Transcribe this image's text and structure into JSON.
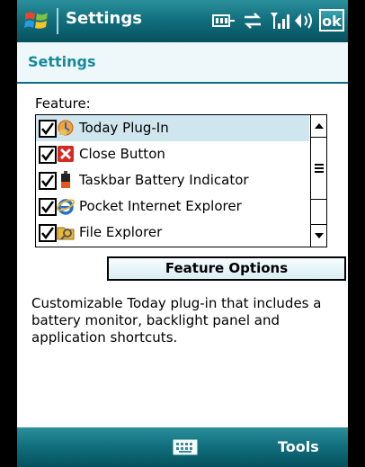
{
  "titlebar": {
    "title": "Settings",
    "start_icon": "windows-flag-icon",
    "status_icons": [
      "connectivity-icon",
      "sync-icon",
      "signal-icon",
      "volume-icon"
    ],
    "ok_label": "ok"
  },
  "header": {
    "title": "Settings"
  },
  "feature_list": {
    "label": "Feature:",
    "items": [
      {
        "label": "Today Plug-In",
        "checked": true,
        "icon": "today-plugin-icon",
        "selected": true
      },
      {
        "label": "Close Button",
        "checked": true,
        "icon": "close-red-x-icon"
      },
      {
        "label": "Taskbar Battery Indicator",
        "checked": true,
        "icon": "battery-icon"
      },
      {
        "label": "Pocket Internet Explorer",
        "checked": true,
        "icon": "internet-explorer-icon"
      },
      {
        "label": "File Explorer",
        "checked": true,
        "icon": "file-explorer-icon"
      }
    ]
  },
  "feature_options_label": "Feature Options",
  "description": "Customizable Today plug-in that includes a battery monitor, backlight panel and application shortcuts.",
  "menubar": {
    "keyboard_icon": "keyboard-icon",
    "tools_label": "Tools"
  },
  "colors": {
    "accent": "#0c6f80",
    "header_text": "#16899c",
    "selection": "#cfe6ee"
  }
}
